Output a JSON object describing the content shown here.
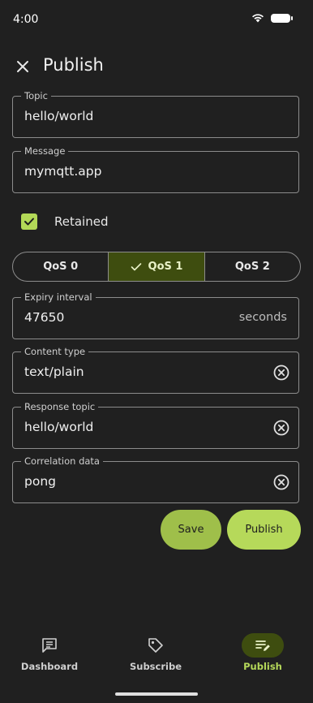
{
  "status": {
    "time": "4:00"
  },
  "app_bar": {
    "title": "Publish"
  },
  "fields": {
    "topic": {
      "label": "Topic",
      "value": "hello/world"
    },
    "message": {
      "label": "Message",
      "value": "mymqtt.app"
    },
    "expiry": {
      "label": "Expiry interval",
      "value": "47650",
      "suffix": "seconds"
    },
    "content_type": {
      "label": "Content type",
      "value": "text/plain"
    },
    "response_topic": {
      "label": "Response topic",
      "value": "hello/world"
    },
    "correlation": {
      "label": "Correlation data",
      "value": "pong"
    }
  },
  "retained": {
    "label": "Retained",
    "checked": true
  },
  "qos": {
    "options": [
      "QoS 0",
      "QoS 1",
      "QoS 2"
    ],
    "selected": "QoS 1"
  },
  "buttons": {
    "save": "Save",
    "publish": "Publish"
  },
  "nav": {
    "items": [
      {
        "label": "Dashboard",
        "icon": "dashboard-icon"
      },
      {
        "label": "Subscribe",
        "icon": "tag-icon"
      },
      {
        "label": "Publish",
        "icon": "publish-icon",
        "active": true
      }
    ]
  },
  "colors": {
    "accent": "#b6d95a",
    "selected_bg": "#3e4d0f",
    "background": "#202020"
  }
}
